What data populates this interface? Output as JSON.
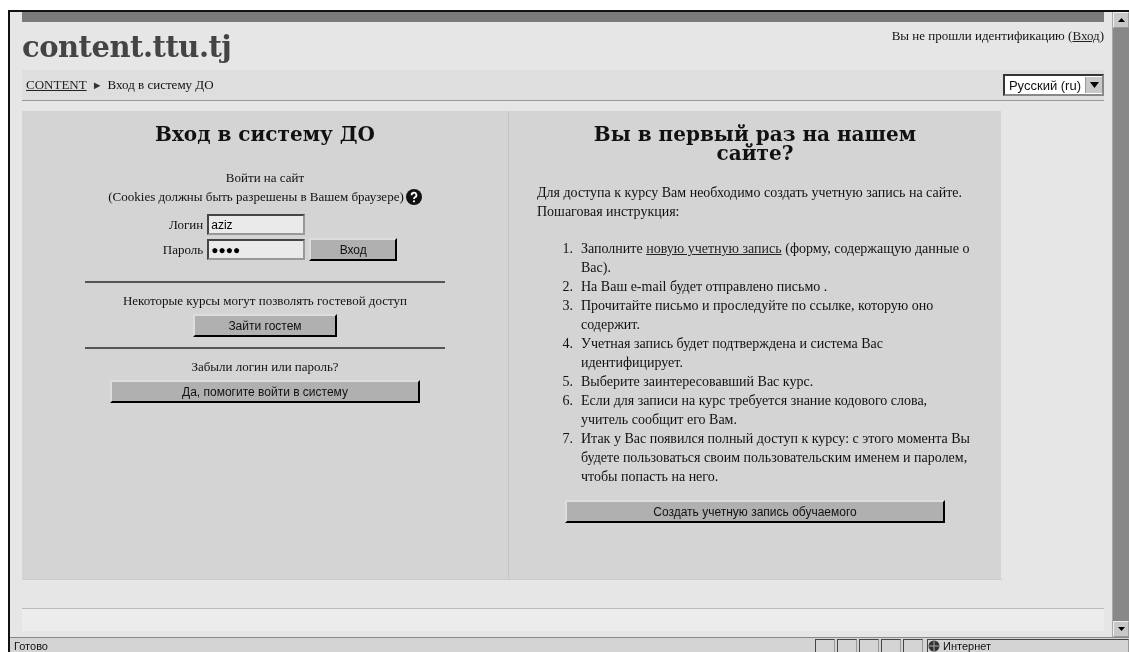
{
  "header": {
    "logo": "content.ttu.tj",
    "login_info": {
      "before": "Вы не прошли идентификацию (",
      "link": "Вход",
      "after": ")"
    }
  },
  "breadcrumb": {
    "items": [
      {
        "label": "CONTENT",
        "kind": "link"
      },
      {
        "label": "Вход в систему ДО",
        "kind": "text"
      }
    ],
    "separator": "►"
  },
  "language_select": {
    "value": "Русский (ru)"
  },
  "login_panel": {
    "title": "Вход в систему ДО",
    "intro": "Войти на сайт",
    "cookies_note": "(Cookies должны быть разрешены в Вашем браузере)",
    "fields": [
      {
        "label": "Логин",
        "value": "aziz"
      },
      {
        "label": "Пароль",
        "value": "●●●●"
      }
    ],
    "login_button": "Вход",
    "guest_text": "Некоторые курсы могут позволять гостевой доступ",
    "guest_button": "Зайти гостем",
    "forgot_text": "Забыли логин или пароль?",
    "forgot_button": "Да, помогите войти в систему"
  },
  "signup_panel": {
    "title": "Вы в первый раз на нашем сайте?",
    "paragraphs": [
      "Для доступа к курсу Вам необходимо создать учетную запись на сайте.",
      "Пошаговая инструкция:"
    ],
    "steps": [
      {
        "number": "1.",
        "before": "Заполните ",
        "link": "новую учетную запись",
        "after": " (форму, содержащую данные о Вас)."
      },
      {
        "number": "2.",
        "before": "На Ваш e-mail будет отправлено письмо ."
      },
      {
        "number": "3.",
        "before": "Прочитайте письмо и проследуйте по ссылке, которую оно содержит."
      },
      {
        "number": "4.",
        "before": "Учетная запись будет подтверждена и система Вас идентифицирует."
      },
      {
        "number": "5.",
        "before": "Выберите заинтересовавший Вас курс."
      },
      {
        "number": "6.",
        "before": "Если для записи на курс требуется знание кодового слова, учитель сообщит его Вам."
      },
      {
        "number": "7.",
        "before": "Итак у Вас появился полный доступ к курсу: с этого момента Вы будете пользоваться своим пользовательским именем и паролем, чтобы попасть на него."
      }
    ],
    "button": "Создать учетную запись обучаемого"
  },
  "status_bar": {
    "text": "Готово",
    "zone": "Интернет"
  }
}
